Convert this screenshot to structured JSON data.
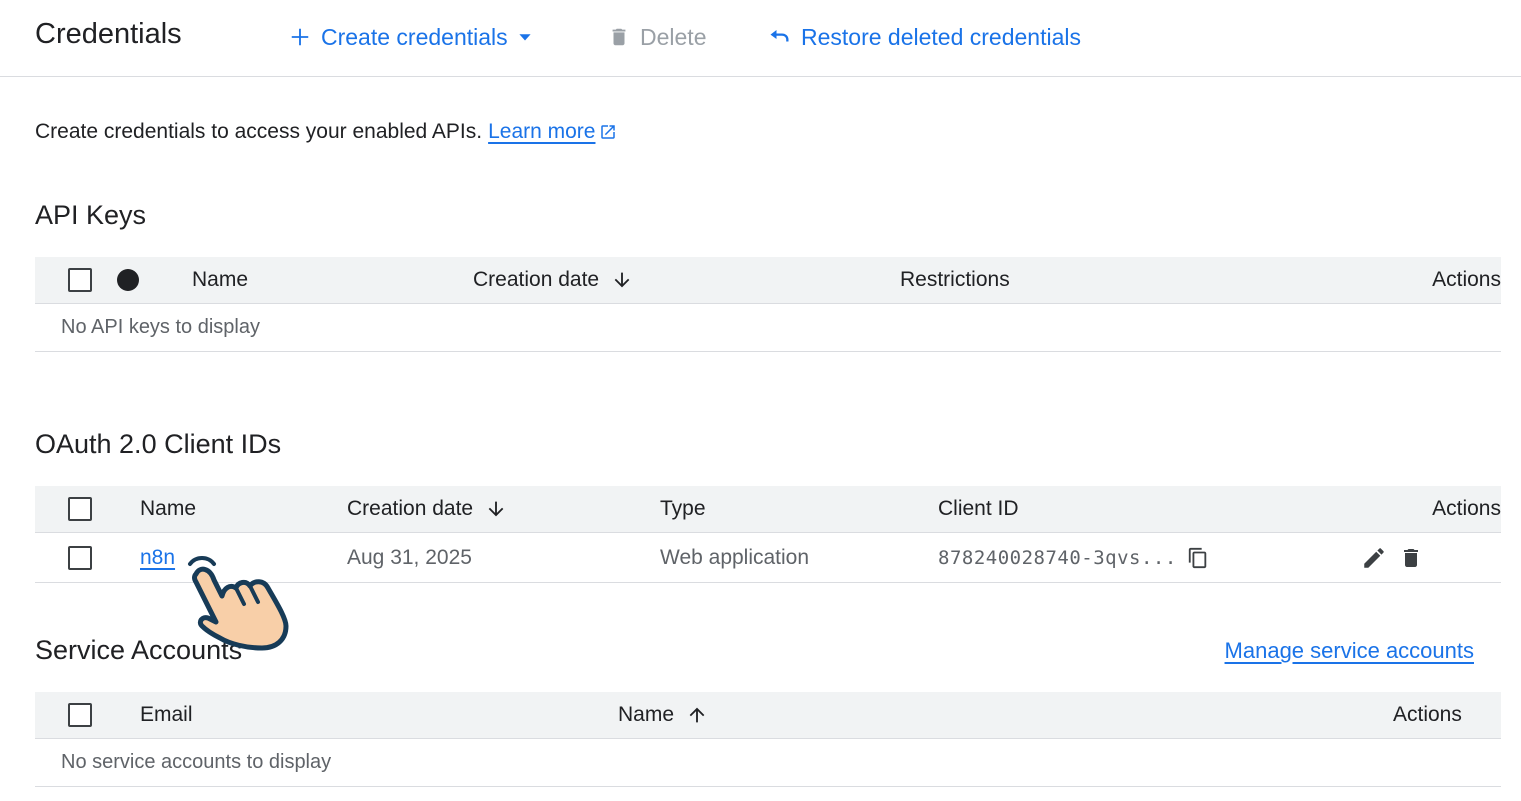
{
  "header": {
    "title": "Credentials",
    "create_label": "Create credentials",
    "delete_label": "Delete",
    "restore_label": "Restore deleted credentials"
  },
  "intro": {
    "text": "Create credentials to access your enabled APIs.",
    "learn_more": "Learn more"
  },
  "api_keys": {
    "title": "API Keys",
    "columns": {
      "name": "Name",
      "creation_date": "Creation date",
      "restrictions": "Restrictions",
      "actions": "Actions"
    },
    "empty": "No API keys to display"
  },
  "oauth": {
    "title": "OAuth 2.0 Client IDs",
    "columns": {
      "name": "Name",
      "creation_date": "Creation date",
      "type": "Type",
      "client_id": "Client ID",
      "actions": "Actions"
    },
    "rows": [
      {
        "name": "n8n",
        "creation_date": "Aug 31, 2025",
        "type": "Web application",
        "client_id": "878240028740-3qvs..."
      }
    ]
  },
  "service_accounts": {
    "title": "Service Accounts",
    "manage_link": "Manage service accounts",
    "columns": {
      "email": "Email",
      "name": "Name",
      "actions": "Actions"
    },
    "empty": "No service accounts to display"
  },
  "colors": {
    "accent": "#1a73e8",
    "header_bg": "#f1f3f4",
    "divider": "#dadce0",
    "disabled": "#9aa0a6"
  },
  "icons": [
    "plus-icon",
    "caret-down-icon",
    "trash-icon",
    "undo-icon",
    "external-link-icon",
    "arrow-down-icon",
    "arrow-up-icon",
    "copy-icon",
    "pencil-icon",
    "pointing-hand-icon"
  ]
}
